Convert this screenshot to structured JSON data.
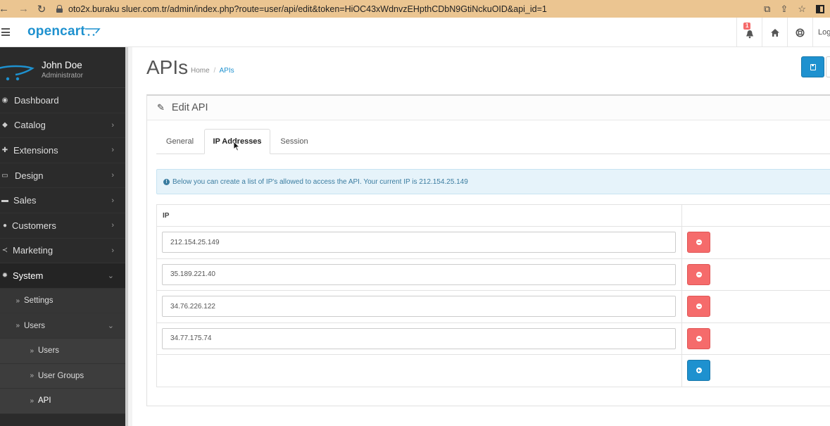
{
  "browser": {
    "url": "oto2x.buraku sluer.com.tr/admin/index.php?route=user/api/edit&token=HiOC43xWdnvzEHpthCDbN9GtiNckuOID&api_id=1"
  },
  "header": {
    "logo": "opencart",
    "notification_count": "1",
    "logout_label": "Log"
  },
  "user": {
    "name": "John Doe",
    "role": "Administrator"
  },
  "sidebar": {
    "items": [
      {
        "label": "Dashboard",
        "icon": "dashboard-icon"
      },
      {
        "label": "Catalog",
        "icon": "tag-icon"
      },
      {
        "label": "Extensions",
        "icon": "puzzle-icon"
      },
      {
        "label": "Design",
        "icon": "monitor-icon"
      },
      {
        "label": "Sales",
        "icon": "cart-icon"
      },
      {
        "label": "Customers",
        "icon": "user-icon"
      },
      {
        "label": "Marketing",
        "icon": "share-icon"
      },
      {
        "label": "System",
        "icon": "cog-icon"
      }
    ],
    "system_sub": {
      "settings": "Settings",
      "users": "Users",
      "users_sub": [
        "Users",
        "User Groups",
        "API"
      ]
    }
  },
  "page": {
    "title": "APIs",
    "breadcrumb": {
      "home": "Home",
      "sep": "/",
      "current": "APIs"
    },
    "panel_title": "Edit API",
    "tabs": [
      "General",
      "IP Addresses",
      "Session"
    ],
    "active_tab": "IP Addresses",
    "alert": "Below you can create a list of IP's allowed to access the API. Your current IP is 212.154.25.149",
    "table": {
      "column_ip": "IP",
      "rows": [
        "212.154.25.149",
        "35.189.221.40",
        "34.76.226.122",
        "34.77.175.74"
      ]
    }
  },
  "colors": {
    "primary": "#1e91cf",
    "danger": "#f56b6b",
    "sidebar_bg": "#2b2b2b",
    "browser_bar": "#ebc591"
  }
}
